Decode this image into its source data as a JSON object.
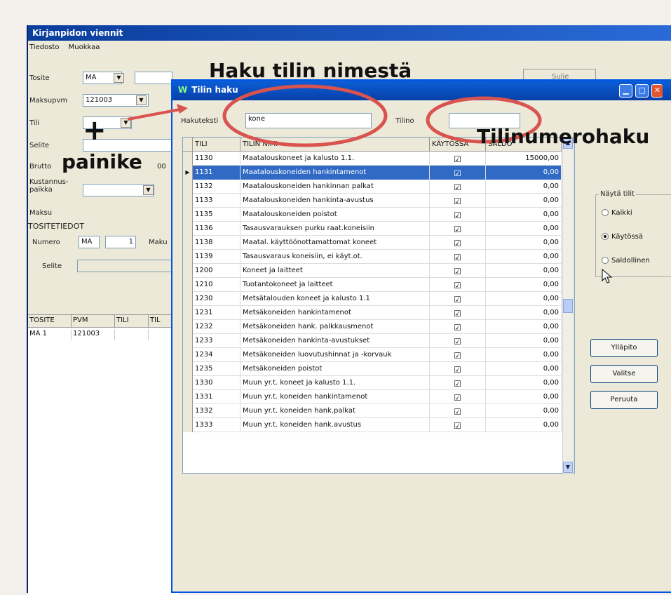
{
  "main": {
    "title": "Kirjanpidon viennit",
    "menu": [
      "Tiedosto",
      "Muokkaa"
    ],
    "labels": {
      "tosite": "Tosite",
      "maksupvm": "Maksupvm",
      "tili": "Tili",
      "selite": "Selite",
      "brutto": "Brutto",
      "kustannuspaikka": "Kustannus-\npaikka",
      "maksu": "Maksu",
      "tositetiedot": "TOSITETIEDOT",
      "numero": "Numero",
      "maku": "Maku",
      "selite2": "Selite"
    },
    "values": {
      "tosite": "MA",
      "maksupvm": "121003",
      "brutto_suffix": "00",
      "numero_prefix": "MA",
      "numero": "1"
    },
    "grid": {
      "headers": [
        "TOSITE",
        "PVM",
        "TILI",
        "TIL"
      ],
      "row": [
        "MA  1",
        "121003",
        "",
        ""
      ]
    },
    "partial_button": "Sulje"
  },
  "dialog": {
    "title": "Tilin haku",
    "hakuteksti_label": "Hakuteksti",
    "hakuteksti_value": "kone",
    "tilino_label": "Tilino",
    "tilino_value": "",
    "columns": [
      "TILI",
      "TILIN NIMI",
      "KÄYTÖSSÄ",
      "SALDO"
    ],
    "rows": [
      {
        "tili": "1130",
        "nimi": "Maatalouskoneet ja kalusto 1.1.",
        "kaytossa": "☑",
        "saldo": "15000,00"
      },
      {
        "tili": "1131",
        "nimi": "Maatalouskoneiden hankintamenot",
        "kaytossa": "☑",
        "saldo": "0,00"
      },
      {
        "tili": "1132",
        "nimi": "Maatalouskoneiden hankinnan palkat",
        "kaytossa": "☑",
        "saldo": "0,00"
      },
      {
        "tili": "1133",
        "nimi": "Maatalouskoneiden hankinta-avustus",
        "kaytossa": "☑",
        "saldo": "0,00"
      },
      {
        "tili": "1135",
        "nimi": "Maatalouskoneiden poistot",
        "kaytossa": "☑",
        "saldo": "0,00"
      },
      {
        "tili": "1136",
        "nimi": "Tasausvarauksen purku raat.koneisiin",
        "kaytossa": "☑",
        "saldo": "0,00"
      },
      {
        "tili": "1138",
        "nimi": "Maatal. käyttöönottamattomat koneet",
        "kaytossa": "☑",
        "saldo": "0,00"
      },
      {
        "tili": "1139",
        "nimi": "Tasausvaraus koneisiin, ei käyt.ot.",
        "kaytossa": "☑",
        "saldo": "0,00"
      },
      {
        "tili": "1200",
        "nimi": "Koneet ja laitteet",
        "kaytossa": "☑",
        "saldo": "0,00"
      },
      {
        "tili": "1210",
        "nimi": "Tuotantokoneet ja laitteet",
        "kaytossa": "☑",
        "saldo": "0,00"
      },
      {
        "tili": "1230",
        "nimi": "Metsätalouden koneet ja kalusto 1.1",
        "kaytossa": "☑",
        "saldo": "0,00"
      },
      {
        "tili": "1231",
        "nimi": "Metsäkoneiden hankintamenot",
        "kaytossa": "☑",
        "saldo": "0,00"
      },
      {
        "tili": "1232",
        "nimi": "Metsäkoneiden hank. palkkausmenot",
        "kaytossa": "☑",
        "saldo": "0,00"
      },
      {
        "tili": "1233",
        "nimi": "Metsäkoneiden hankinta-avustukset",
        "kaytossa": "☑",
        "saldo": "0,00"
      },
      {
        "tili": "1234",
        "nimi": "Metsäkoneiden luovutushinnat ja -korvauk",
        "kaytossa": "☑",
        "saldo": "0,00"
      },
      {
        "tili": "1235",
        "nimi": "Metsäkoneiden poistot",
        "kaytossa": "☑",
        "saldo": "0,00"
      },
      {
        "tili": "1330",
        "nimi": "Muun yr.t. koneet ja kalusto 1.1.",
        "kaytossa": "☑",
        "saldo": "0,00"
      },
      {
        "tili": "1331",
        "nimi": "Muun yr.t. koneiden hankintamenot",
        "kaytossa": "☑",
        "saldo": "0,00"
      },
      {
        "tili": "1332",
        "nimi": "Muun yr.t. koneiden hank.palkat",
        "kaytossa": "☑",
        "saldo": "0,00"
      },
      {
        "tili": "1333",
        "nimi": "Muun yr.t. koneiden hank.avustus",
        "kaytossa": "☑",
        "saldo": "0,00"
      }
    ],
    "selected_row": 1,
    "filter": {
      "legend": "Näytä tilit",
      "options": [
        "Kaikki",
        "Käytössä",
        "Saldollinen"
      ],
      "selected": 1
    },
    "buttons": {
      "yllapito": "Ylläpito",
      "valitse": "Valitse",
      "peruuta": "Peruuta"
    }
  },
  "annotations": {
    "haku_nimesta": "Haku tilin nimestä",
    "tilinumerohaku": "Tilinumerohaku",
    "plus": "+",
    "painike": "painike",
    "color_ellipse": "#d9534f",
    "color_arrow": "#d9534f"
  }
}
